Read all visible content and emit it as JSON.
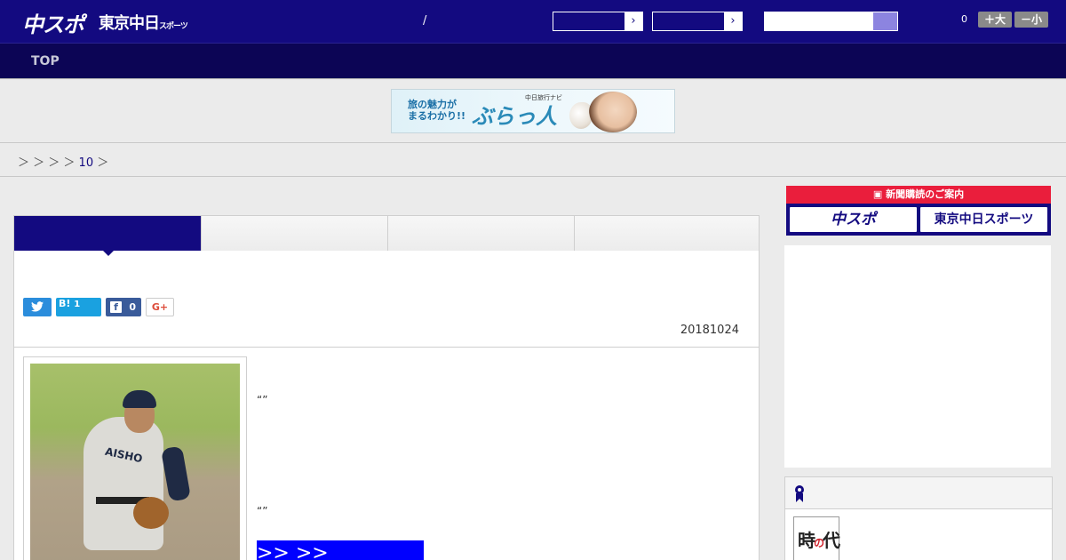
{
  "header": {
    "logo_main": "中スポ",
    "logo_sub": "東京中日",
    "logo_sub_small": "スポーツ",
    "slash": "/",
    "font_count": "0",
    "font_plus": "＋大",
    "font_minus": "－小"
  },
  "nav": {
    "top_label": "TOP"
  },
  "banner": {
    "line1": "旅の魅力が",
    "line2": "まるわかり!!",
    "small": "中日旅行ナビ",
    "title": "ぶらっ人"
  },
  "breadcrumb": {
    "separators": "＞ ＞ ＞ ＞",
    "link": "10",
    "tail": "＞"
  },
  "share": {
    "hatena_label": "B!",
    "hatena_count": "1",
    "facebook_count": "0",
    "gplus_label": "G+"
  },
  "article": {
    "date": "20181024",
    "quote1": "“”",
    "quote2": "“”",
    "more_link": ">> >>",
    "photo_jersey": "AISHO"
  },
  "sidebar": {
    "subscribe_head": "新聞購読のご案内",
    "subscribe_btn1": "中スポ",
    "subscribe_btn2": "東京中日スポーツ",
    "thumb_text1": "時",
    "thumb_text2": "代",
    "thumb_red": "の"
  },
  "colors": {
    "header_bg": "#130a80",
    "nav_bg": "#0c0555",
    "accent_red": "#ea1e3c",
    "link_blue": "#0000ff"
  }
}
